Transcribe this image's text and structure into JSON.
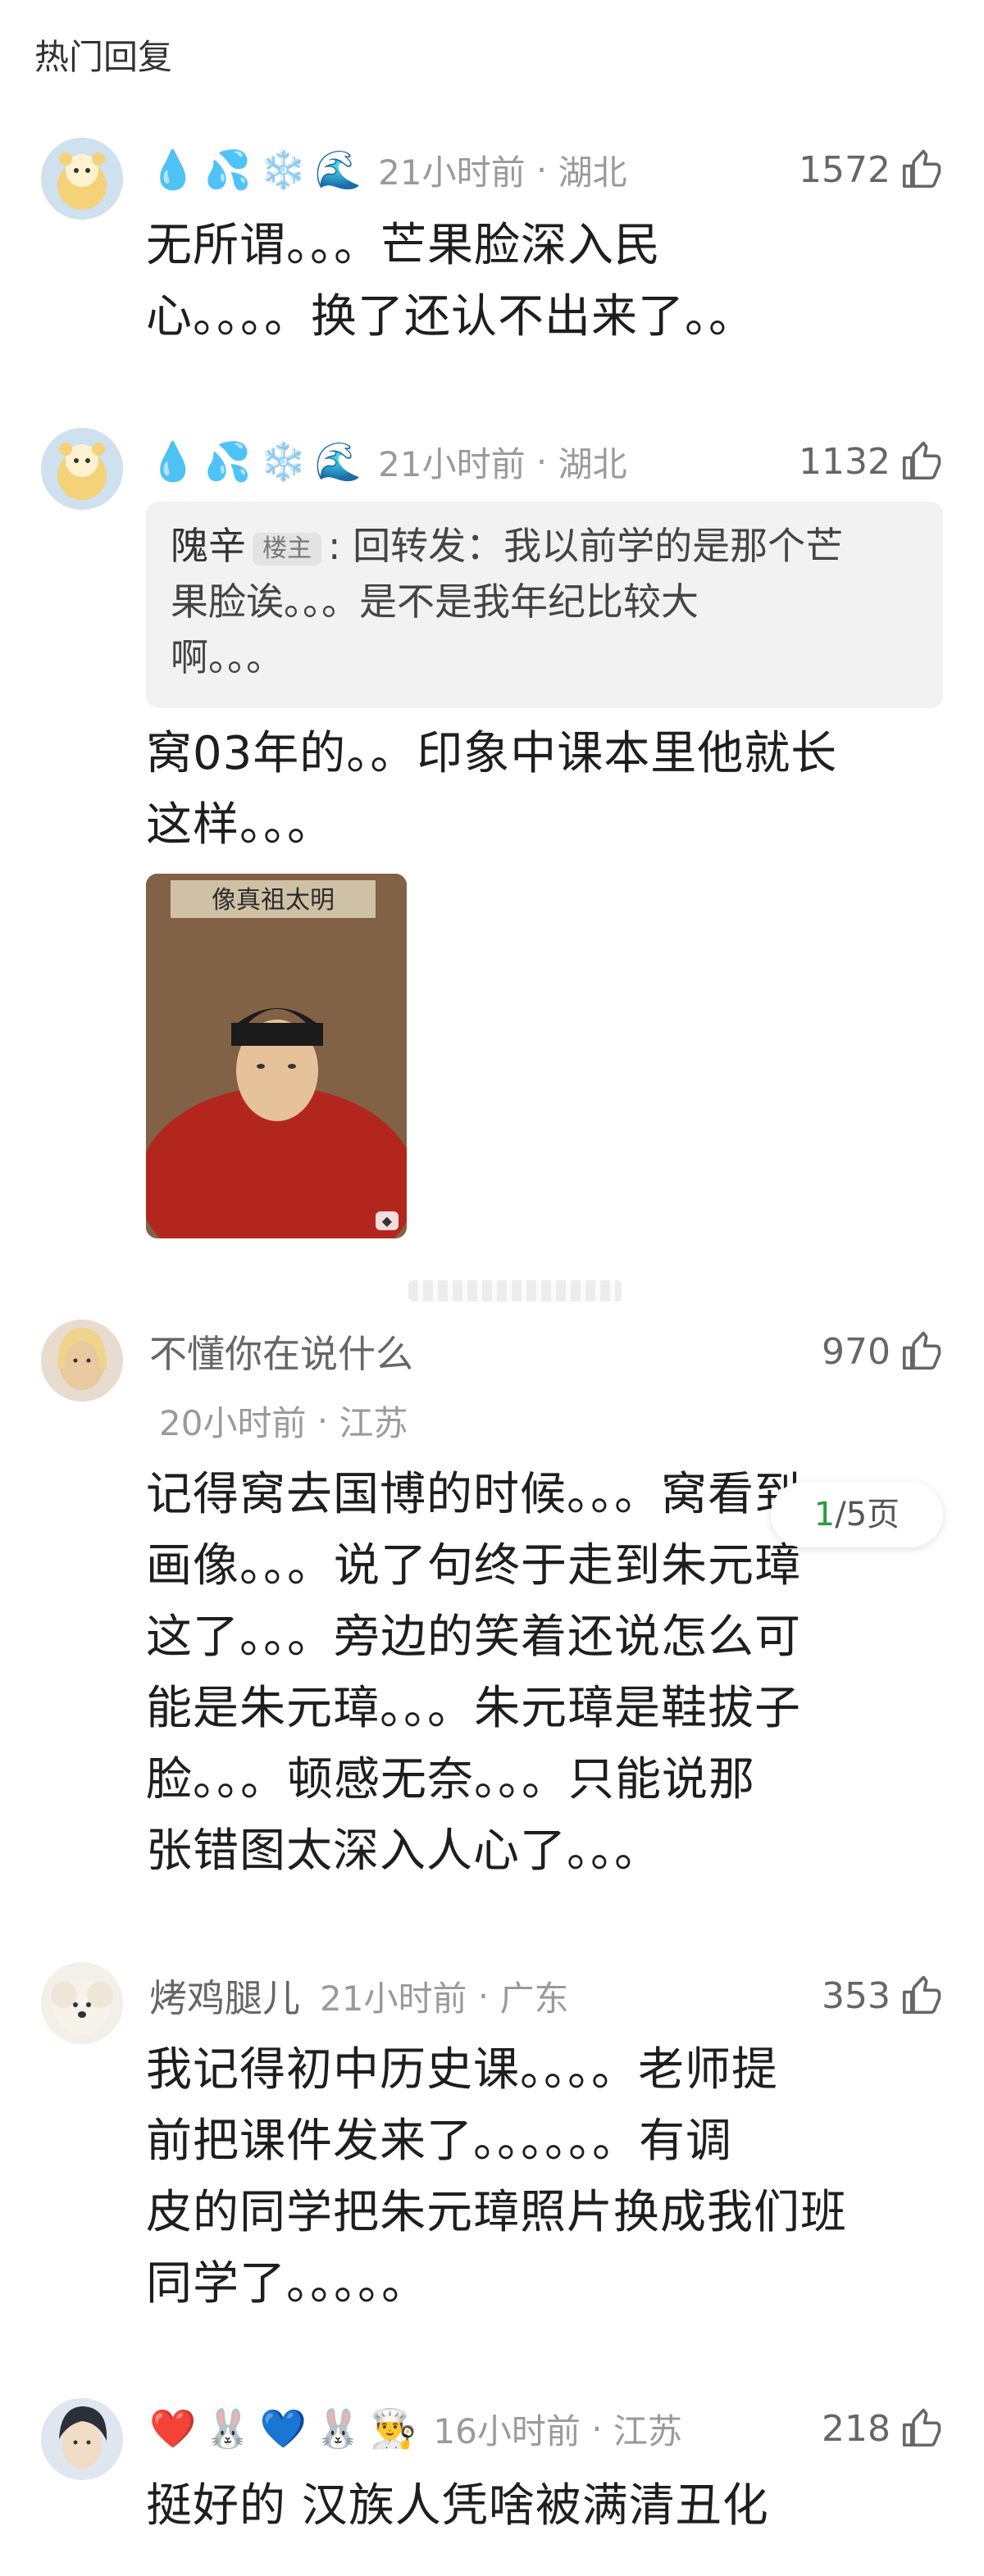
{
  "section_title": "热门回复",
  "comments": [
    {
      "emojis": [
        "💧",
        "💦",
        "❄️",
        "🌊"
      ],
      "time": "21小时前",
      "location": "湖北",
      "likes": "1572",
      "text_lines": [
        "无所谓。。。芒果脸深入民",
        "心。。。。换了还认不出来了。。"
      ]
    },
    {
      "emojis": [
        "💧",
        "💦",
        "❄️",
        "🌊"
      ],
      "time": "21小时前",
      "location": "湖北",
      "likes": "1132",
      "quote": {
        "name": "隗辛",
        "badge": "楼主",
        "lines": [
          ": 回转发：我以前学的是那个芒",
          "果脸诶。。。是不是我年纪比较大",
          "啊。。。"
        ]
      },
      "text_lines": [
        "窝03年的。。印象中课本里他就长",
        "这样。。。"
      ],
      "image_caption": "像真祖太明"
    },
    {
      "username": "不懂你在说什么",
      "time": "20小时前",
      "location": "江苏",
      "likes": "970",
      "text_lines": [
        "记得窝去国博的时候。。。窝看到",
        "画像。。。说了句终于走到朱元璋",
        "这了。。。旁边的笑着还说怎么可",
        "能是朱元璋。。。朱元璋是鞋拔子",
        "脸。。。顿感无奈。。。只能说那",
        "张错图太深入人心了。。。"
      ]
    },
    {
      "username": "烤鸡腿儿",
      "time": "21小时前",
      "location": "广东",
      "likes": "353",
      "text_lines": [
        "我记得初中历史课。。。。老师提",
        "前把课件发来了。。。。。。有调",
        "皮的同学把朱元璋照片换成我们班",
        "同学了。。。。。"
      ]
    },
    {
      "emojis": [
        "❤️",
        "🐰",
        "💙",
        "🐰",
        "👨‍🍳"
      ],
      "time": "16小时前",
      "location": "江苏",
      "likes": "218",
      "text_lines": [
        "挺好的 汉族人凭啥被满清丑化"
      ]
    }
  ],
  "page_indicator": {
    "current": "1",
    "total": "/5页"
  }
}
